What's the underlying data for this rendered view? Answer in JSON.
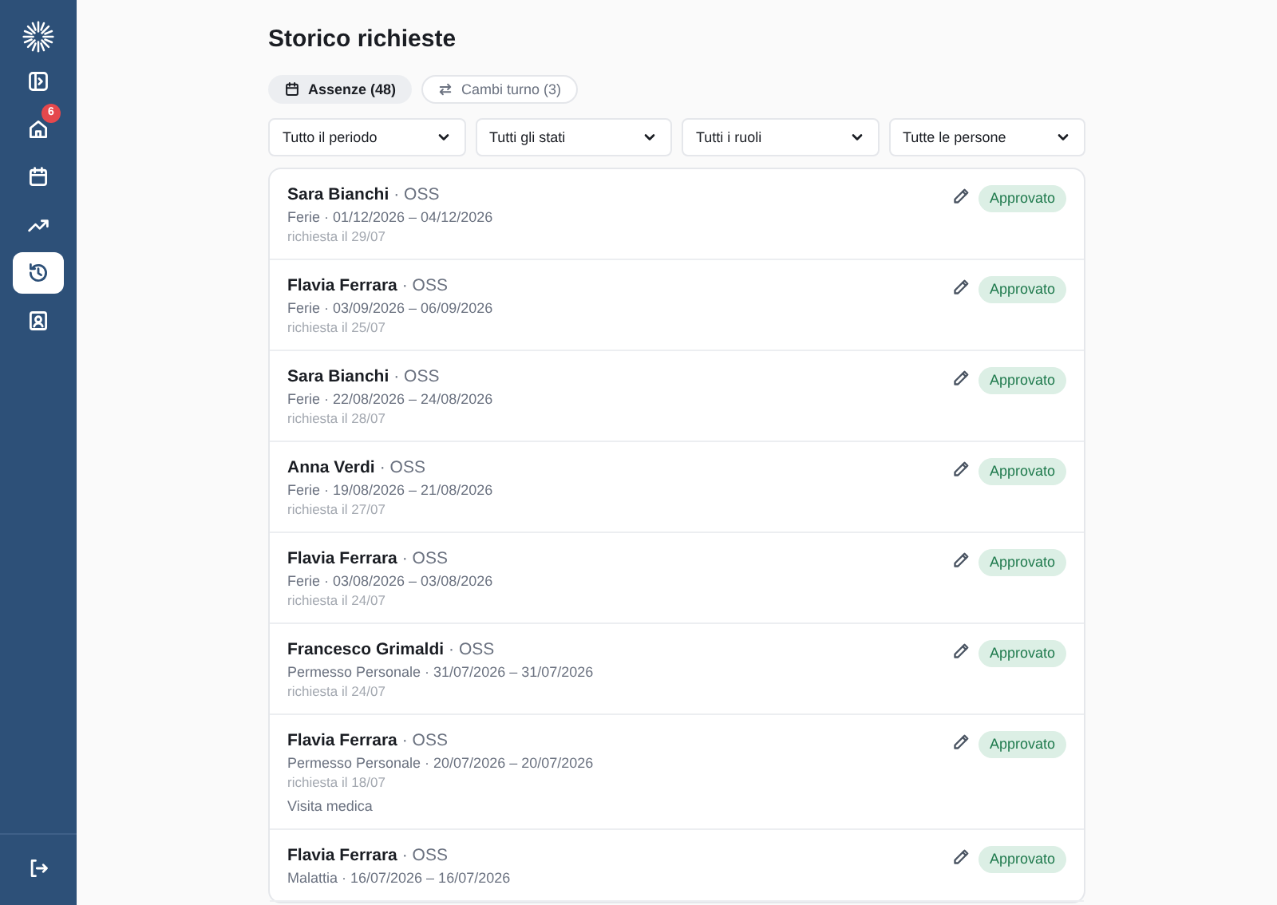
{
  "sidebar": {
    "items": [
      {
        "kind": "panel",
        "selected": false
      },
      {
        "kind": "home",
        "selected": false,
        "badge": "6"
      },
      {
        "kind": "calendar",
        "selected": false
      },
      {
        "kind": "trend",
        "selected": false
      },
      {
        "kind": "history",
        "selected": true
      },
      {
        "kind": "contact",
        "selected": false
      }
    ],
    "footer": {
      "kind": "logout"
    }
  },
  "title": "Storico richieste",
  "tabs": [
    {
      "label": "Assenze (48)",
      "kind": "calendar",
      "selected": true
    },
    {
      "label": "Cambi turno (3)",
      "kind": "swap",
      "selected": false
    }
  ],
  "filters": [
    {
      "value": "Tutto il periodo"
    },
    {
      "value": "Tutti gli stati"
    },
    {
      "value": "Tutti i ruoli"
    },
    {
      "value": "Tutte le persone"
    }
  ],
  "requests": [
    {
      "name": "Sara Bianchi",
      "role": "· OSS",
      "detail": "Ferie · 01/12/2026 – 04/12/2026",
      "requested": "richiesta il 29/07",
      "status": {
        "label": "Approvato",
        "kind": "approved"
      }
    },
    {
      "name": "Flavia Ferrara",
      "role": "· OSS",
      "detail": "Ferie · 03/09/2026 – 06/09/2026",
      "requested": "richiesta il 25/07",
      "status": {
        "label": "Approvato",
        "kind": "approved"
      }
    },
    {
      "name": "Sara Bianchi",
      "role": "· OSS",
      "detail": "Ferie · 22/08/2026 – 24/08/2026",
      "requested": "richiesta il 28/07",
      "status": {
        "label": "Approvato",
        "kind": "approved"
      }
    },
    {
      "name": "Anna Verdi",
      "role": "· OSS",
      "detail": "Ferie · 19/08/2026 – 21/08/2026",
      "requested": "richiesta il 27/07",
      "status": {
        "label": "Approvato",
        "kind": "approved"
      }
    },
    {
      "name": "Flavia Ferrara",
      "role": "· OSS",
      "detail": "Ferie · 03/08/2026 – 03/08/2026",
      "requested": "richiesta il 24/07",
      "status": {
        "label": "Approvato",
        "kind": "approved"
      }
    },
    {
      "name": "Francesco Grimaldi",
      "role": "· OSS",
      "detail": "Permesso Personale · 31/07/2026 – 31/07/2026",
      "requested": "richiesta il 24/07",
      "status": {
        "label": "Approvato",
        "kind": "approved"
      }
    },
    {
      "name": "Flavia Ferrara",
      "role": "· OSS",
      "detail": "Permesso Personale · 20/07/2026 – 20/07/2026",
      "requested": "richiesta il 18/07",
      "note": "Visita medica",
      "status": {
        "label": "Approvato",
        "kind": "approved"
      }
    },
    {
      "name": "Flavia Ferrara",
      "role": "· OSS",
      "detail": "Malattia · 16/07/2026 – 16/07/2026",
      "status": {
        "label": "Approvato",
        "kind": "approved"
      }
    }
  ]
}
